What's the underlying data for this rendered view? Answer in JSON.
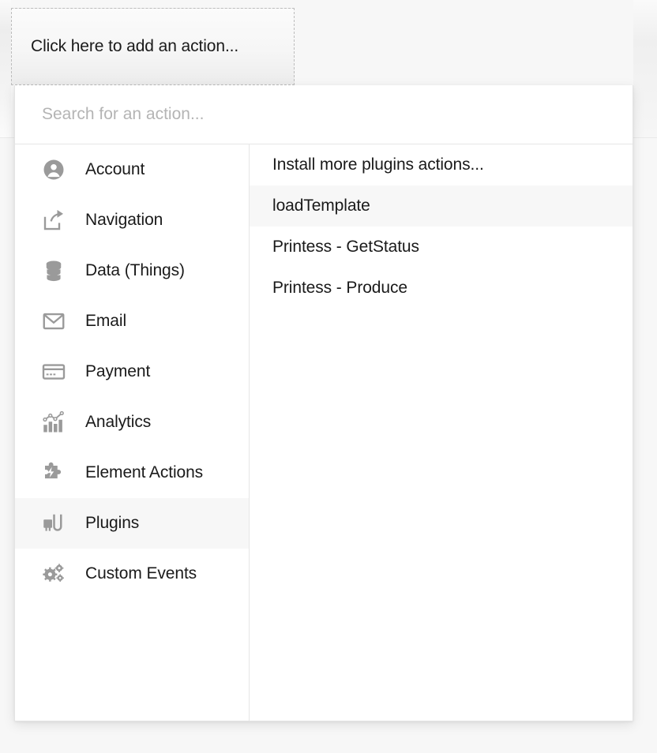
{
  "placeholder_box": {
    "label": "Click here to add an action..."
  },
  "search": {
    "placeholder": "Search for an action...",
    "value": ""
  },
  "categories": [
    {
      "label": "Account",
      "icon": "user-circle-icon",
      "selected": false
    },
    {
      "label": "Navigation",
      "icon": "share-arrow-icon",
      "selected": false
    },
    {
      "label": "Data (Things)",
      "icon": "database-icon",
      "selected": false
    },
    {
      "label": "Email",
      "icon": "envelope-icon",
      "selected": false
    },
    {
      "label": "Payment",
      "icon": "credit-card-icon",
      "selected": false
    },
    {
      "label": "Analytics",
      "icon": "bar-chart-icon",
      "selected": false
    },
    {
      "label": "Element Actions",
      "icon": "puzzle-bolt-icon",
      "selected": false
    },
    {
      "label": "Plugins",
      "icon": "plug-icon",
      "selected": true
    },
    {
      "label": "Custom Events",
      "icon": "gears-icon",
      "selected": false
    }
  ],
  "actions": [
    {
      "label": "Install more plugins actions...",
      "highlighted": false
    },
    {
      "label": "loadTemplate",
      "highlighted": true
    },
    {
      "label": "Printess - GetStatus",
      "highlighted": false
    },
    {
      "label": "Printess - Produce",
      "highlighted": false
    }
  ],
  "colors": {
    "page_background": "#f7f7f7",
    "panel_background": "#ffffff",
    "border": "#e6e6e6",
    "text": "#1a1a1a",
    "placeholder_text": "#b4b4b4",
    "icon": "#9a9a9a",
    "highlight": "#f7f7f7",
    "dashed_border": "#bdbdbd"
  }
}
